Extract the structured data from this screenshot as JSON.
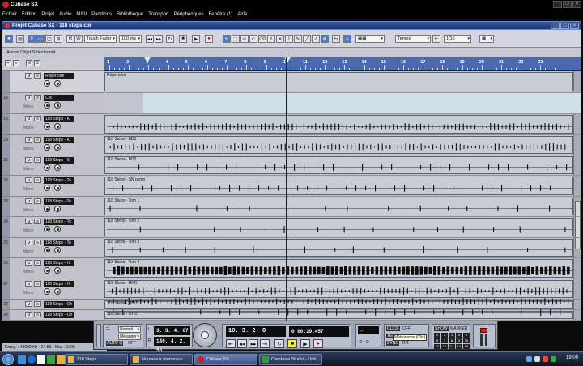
{
  "app": {
    "title": "Cubase SX"
  },
  "menu": [
    "Fichier",
    "Édition",
    "Projet",
    "Audio",
    "MIDI",
    "Partitions",
    "Bibliothèque",
    "Transport",
    "Périphériques",
    "Fenêtre (1)",
    "Aide"
  ],
  "project": {
    "title": "Projet Cubase SX - 118 steps.cpr"
  },
  "toolbar": {
    "automation_mode": "Touch Fader",
    "automation_time": "100 ms",
    "snap_type": "Temps",
    "quantize": "1/16"
  },
  "infoline": {
    "text": "Aucun Objet Sélectionné"
  },
  "ruler": {
    "bars": [
      "1",
      "2",
      "3",
      "4",
      "5",
      "6",
      "7",
      "8",
      "9",
      "10",
      "11",
      "12",
      "13",
      "14",
      "15",
      "16",
      "17",
      "18",
      "19",
      "20",
      "21",
      "22",
      "23"
    ]
  },
  "tracks": [
    {
      "num": "",
      "name": "Répertoire",
      "mode": ""
    },
    {
      "num": "19",
      "name": "Clic",
      "mode": "Mono"
    },
    {
      "num": "19",
      "name": "118 Steps - Ki",
      "mode": "Mono"
    },
    {
      "num": "20",
      "name": "118 Steps - Ki",
      "mode": "Mono"
    },
    {
      "num": "21",
      "name": "118 Steps - Sr",
      "mode": "Mono"
    },
    {
      "num": "22",
      "name": "118 Steps - To",
      "mode": "Mono"
    },
    {
      "num": "23",
      "name": "118 Steps - To",
      "mode": "Mono"
    },
    {
      "num": "24",
      "name": "118 Steps - To",
      "mode": "Mono"
    },
    {
      "num": "25",
      "name": "118 Steps - To",
      "mode": "Mono"
    },
    {
      "num": "26",
      "name": "118 Steps - Hi",
      "mode": "Mono"
    },
    {
      "num": "27",
      "name": "118 Steps - Hi",
      "mode": "Mono"
    },
    {
      "num": "28",
      "name": "118 Steps - Oh",
      "mode": "Mono"
    },
    {
      "num": "29",
      "name": "118 Steps - Oh",
      "mode": "Mono"
    }
  ],
  "parts": [
    {
      "label": "Répertoire"
    },
    {
      "label": ""
    },
    {
      "label": ""
    },
    {
      "label": "118 Steps - BD1"
    },
    {
      "label": "118 Steps - BD2"
    },
    {
      "label": "118 Steps - SN comp"
    },
    {
      "label": "118 Steps - Tom 1"
    },
    {
      "label": "118 Steps - Tom 2"
    },
    {
      "label": "118 Steps - Tom 3"
    },
    {
      "label": "118 Steps - Tom 4"
    },
    {
      "label": "118 Steps - HHC"
    },
    {
      "label": "118 Steps - HHO"
    },
    {
      "label": "118 Steps - OHC"
    }
  ],
  "status": {
    "text": "Enreg. : 48000 Hz - 24 Bit - Max : 130h"
  },
  "transport": {
    "mode1": "Normal",
    "mode2": "Mélanger",
    "auto_q": "AUTO Q",
    "auto_state": "OFF",
    "left_locator": "3. 3. 4. 67",
    "right_locator": "140. 4. 2. 55",
    "position_bars": "10. 3. 2.",
    "position_ticks": "8",
    "position_time": "0:00:19.457",
    "click": "CLICK",
    "click_state": "OFF",
    "tempo": "TEMPO",
    "sync": "SYNC",
    "sync_state": "INT.",
    "tooltip": "Métronome (Clic)",
    "show": "SHOW",
    "marker_label": "MARKER",
    "markers": [
      "1",
      "2",
      "3",
      "4",
      "5",
      "6",
      "7",
      "8",
      "9",
      "10",
      "11",
      "12",
      "13",
      "14",
      "15"
    ]
  },
  "taskbar": {
    "tasks": [
      "118 Steps",
      "Nouveaux morceaux",
      "Cubase SX",
      "Camtasia Studio - Unti..."
    ],
    "clock": "19:00"
  }
}
